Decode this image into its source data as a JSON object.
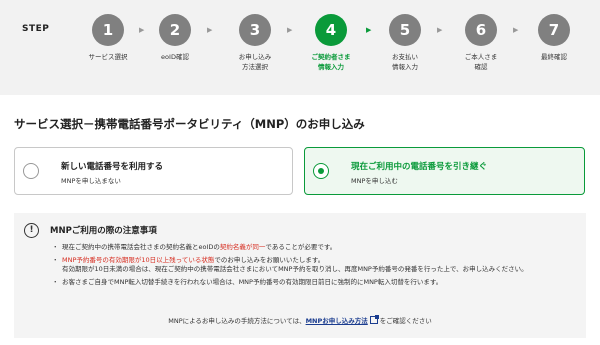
{
  "stepbar": {
    "label": "STEP",
    "steps": [
      {
        "num": "1",
        "label": "サービス選択"
      },
      {
        "num": "2",
        "label": "eoID確認"
      },
      {
        "num": "3",
        "label": "お申し込み\n方法選択"
      },
      {
        "num": "4",
        "label": "ご契約者さま\n情報入力"
      },
      {
        "num": "5",
        "label": "お支払い\n情報入力"
      },
      {
        "num": "6",
        "label": "ご本人さま\n確認"
      },
      {
        "num": "7",
        "label": "最終確認"
      }
    ],
    "active_step": 4,
    "arrow": "▶",
    "colors": {
      "active": "#0a9a3a",
      "inactive": "#808080"
    }
  },
  "page_title": "サービス選択－携帯電話番号ポータビリティ（MNP）のお申し込み",
  "options": [
    {
      "main": "新しい電話番号を利用する",
      "sub": "MNPを申し込まない",
      "selected": false
    },
    {
      "main": "現在ご利用中の電話番号を引き継ぐ",
      "sub": "MNPを申し込む",
      "selected": true
    }
  ],
  "notice": {
    "icon": "!",
    "title": "MNPご利用の際の注意事項",
    "b1_a": "現在ご契約中の携帯電話会社さまの契約名義とeoIDの",
    "b1_red": "契約名義が同一",
    "b1_b": "であることが必要です。",
    "b2_red": "MNP予約番号の有効期限が10日以上残っている状態",
    "b2_a": "でのお申し込みをお願いいたします。",
    "b2_b": "有効期限が10日未満の場合は、現在ご契約中の携帯電話会社さまにおいてMNP予約を取り消し、再度MNP予約番号の発番を行った上で、お申し込みください。",
    "b3": "お客さまご自身でMNP転入切替手続きを行われない場合は、MNP予約番号の有効期限日前日に強制的にMNP転入切替を行います。",
    "footer_a": "MNPによるお申し込みの手続方法については、",
    "footer_link": "MNPお申し込み方法",
    "footer_b": "をご確認ください"
  }
}
